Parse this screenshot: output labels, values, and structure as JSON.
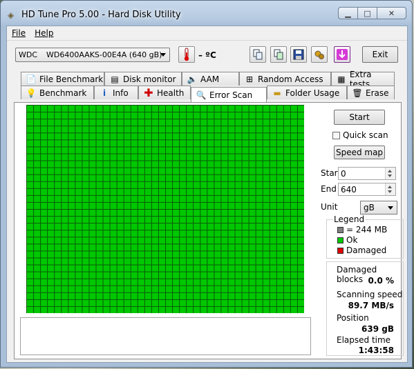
{
  "window": {
    "title": "HD Tune Pro 5.00 - Hard Disk Utility",
    "min": "▁",
    "max": "□",
    "close": "✕"
  },
  "menu": {
    "file": "File",
    "help": "Help"
  },
  "toolbar": {
    "drive_vendor": "WDC",
    "drive_model": "WD6400AAKS-00E4A (640 gB)",
    "temperature": "– ºC",
    "exit_label": "Exit"
  },
  "tabs_row1": [
    {
      "label": "File Benchmark",
      "icon": "file-benchmark-icon"
    },
    {
      "label": "Disk monitor",
      "icon": "disk-monitor-icon"
    },
    {
      "label": "AAM",
      "icon": "speaker-icon"
    },
    {
      "label": "Random Access",
      "icon": "random-access-icon"
    },
    {
      "label": "Extra tests",
      "icon": "extra-tests-icon"
    }
  ],
  "tabs_row2": [
    {
      "label": "Benchmark",
      "icon": "lightbulb-icon"
    },
    {
      "label": "Info",
      "icon": "info-icon"
    },
    {
      "label": "Health",
      "icon": "health-cross-icon"
    },
    {
      "label": "Error Scan",
      "icon": "magnifier-icon",
      "active": true
    },
    {
      "label": "Folder Usage",
      "icon": "folder-icon"
    },
    {
      "label": "Erase",
      "icon": "trash-icon"
    }
  ],
  "scan": {
    "grid_cols": 40,
    "grid_rows": 30,
    "ok_color": "#00c800",
    "damaged_count": 0,
    "start_label": "Start",
    "quick_scan_label": "Quick scan",
    "quick_scan_checked": false,
    "speed_map_label": "Speed map",
    "start_field_label": "Start",
    "start_value": "0",
    "end_field_label": "End",
    "end_value": "640",
    "unit_label": "Unit",
    "unit_value": "gB"
  },
  "legend": {
    "title": "Legend",
    "block_size": "= 244 MB",
    "ok": "Ok",
    "damaged": "Damaged",
    "block_color": "#808080",
    "ok_color": "#00c800",
    "damaged_color": "#e00000"
  },
  "stats": {
    "damaged_blocks_label": "Damaged blocks",
    "damaged_blocks_value": "0.0 %",
    "speed_label": "Scanning speed",
    "speed_value": "89.7 MB/s",
    "position_label": "Position",
    "position_value": "639 gB",
    "elapsed_label": "Elapsed time",
    "elapsed_value": "1:43:58"
  }
}
